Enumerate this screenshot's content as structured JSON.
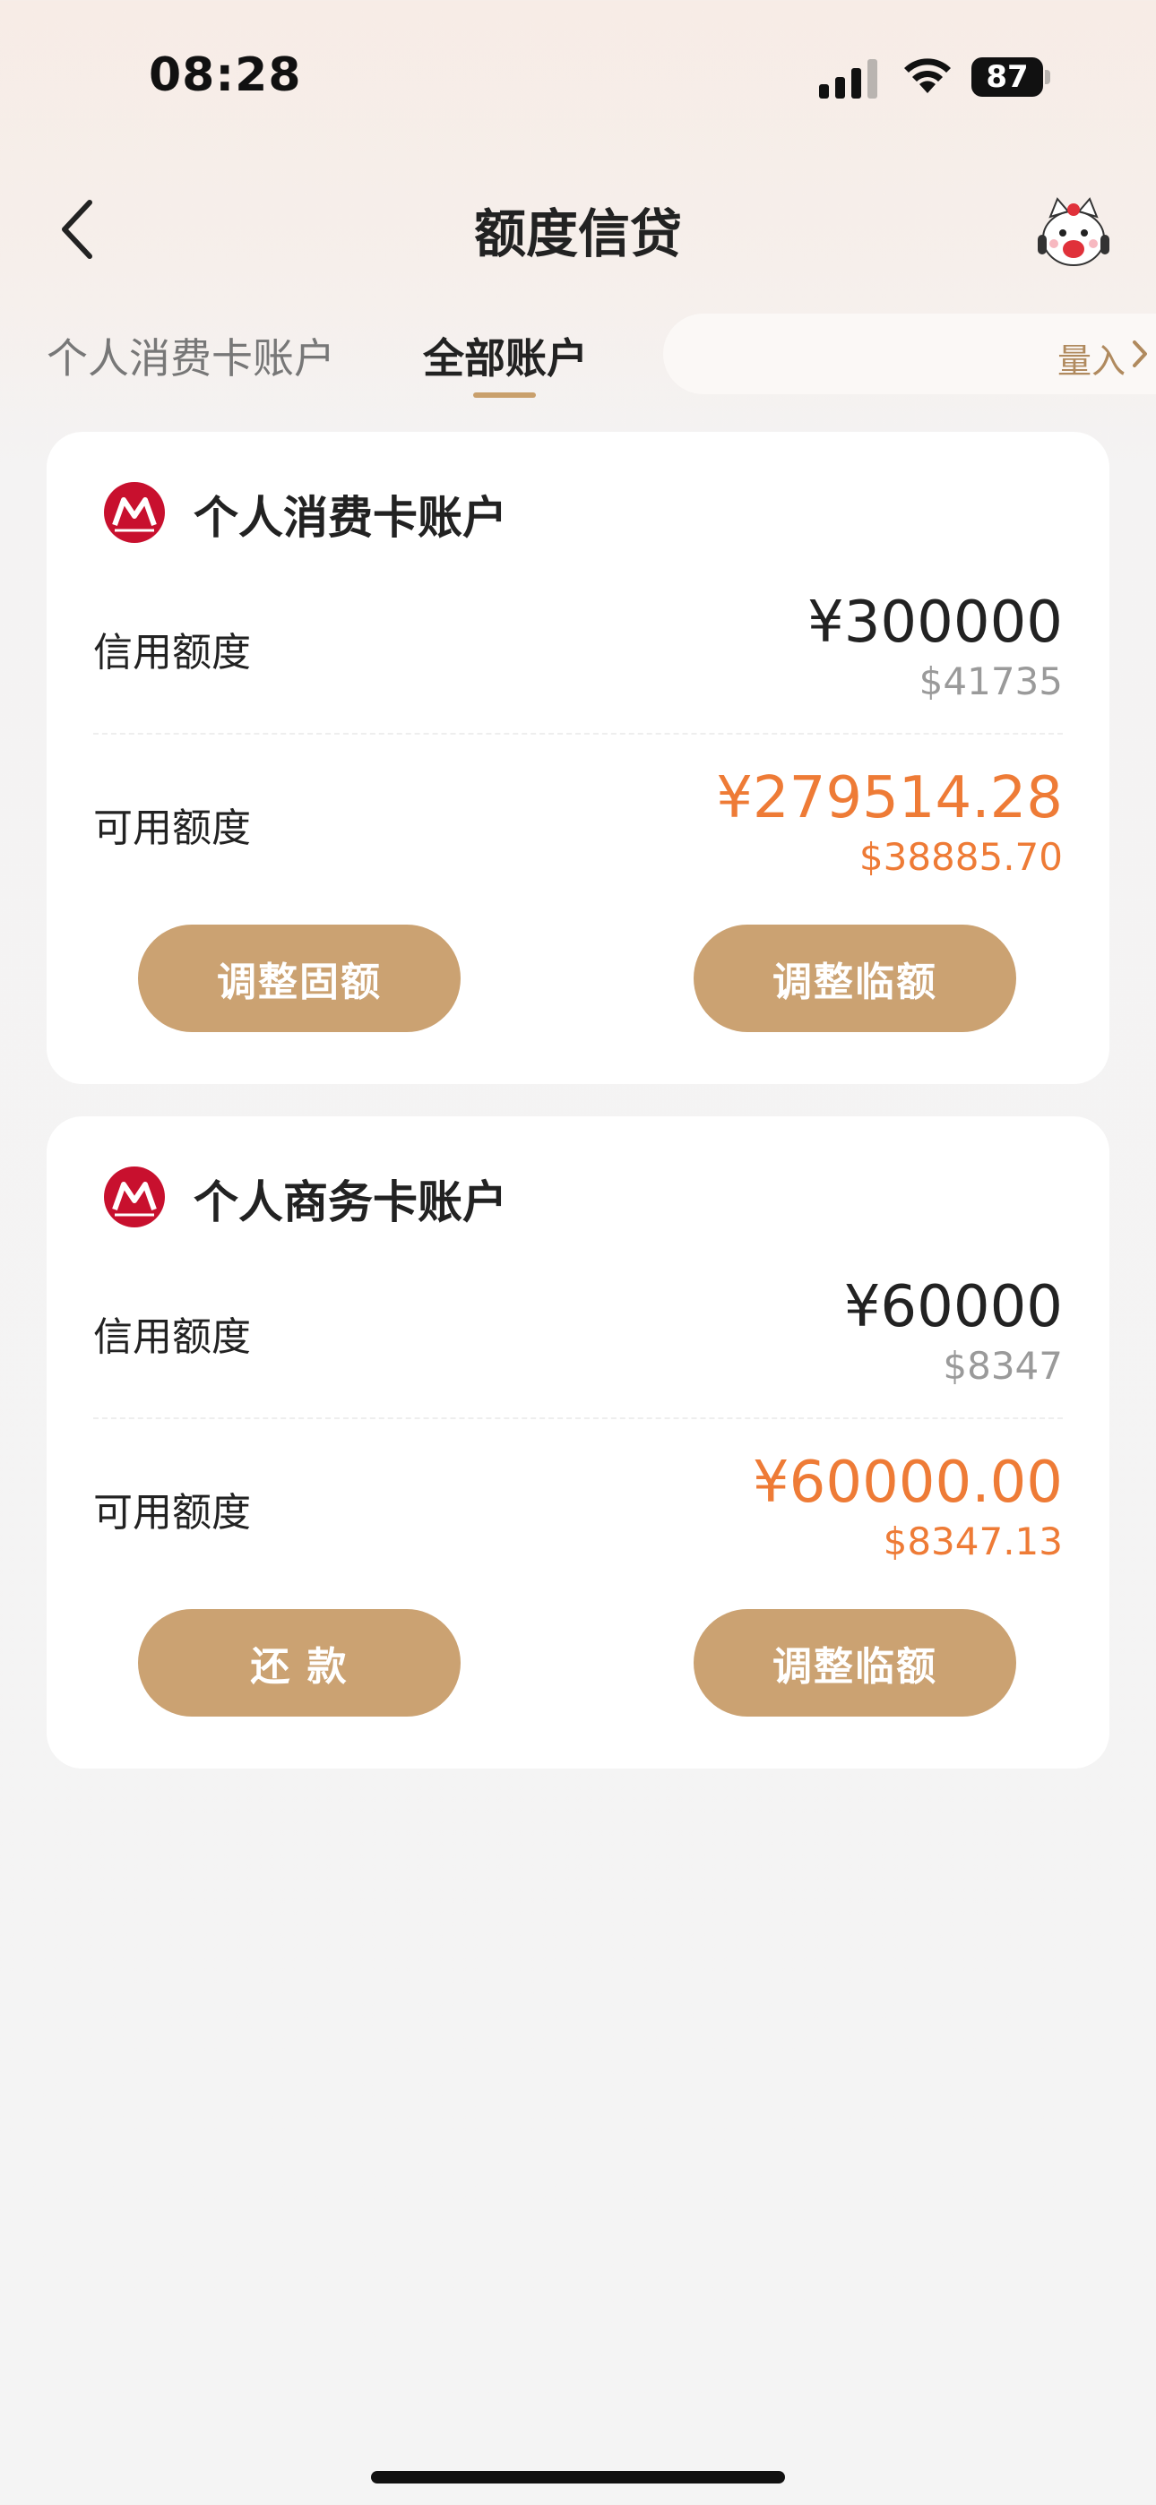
{
  "status_bar": {
    "time": "08:28",
    "battery": "87"
  },
  "nav": {
    "title": "额度信贷"
  },
  "tabs": [
    {
      "label": "个人消费卡账户",
      "active": false
    },
    {
      "label": "全部账户",
      "active": true
    }
  ],
  "tab_extra": {
    "label": "量入"
  },
  "accounts": [
    {
      "name": "个人消费卡账户",
      "credit_label": "信用额度",
      "credit_cny": "¥300000",
      "credit_usd": "$41735",
      "available_label": "可用额度",
      "available_cny": "¥279514.28",
      "available_usd": "$38885.70",
      "btn_left": "调整固额",
      "btn_right": "调整临额"
    },
    {
      "name": "个人商务卡账户",
      "credit_label": "信用额度",
      "credit_cny": "¥60000",
      "credit_usd": "$8347",
      "available_label": "可用额度",
      "available_cny": "¥60000.00",
      "available_usd": "$8347.13",
      "btn_left": "还 款",
      "btn_right": "调整临额"
    }
  ],
  "colors": {
    "accent_button": "#cba272",
    "available_amount": "#ee7b36",
    "tab_underline": "#c9a06c",
    "logo_red": "#c8102e"
  },
  "icons": [
    "signal-icon",
    "wifi-icon",
    "battery-icon",
    "back-arrow-icon",
    "mascot-icon",
    "chevron-right-icon",
    "bank-logo-icon"
  ]
}
